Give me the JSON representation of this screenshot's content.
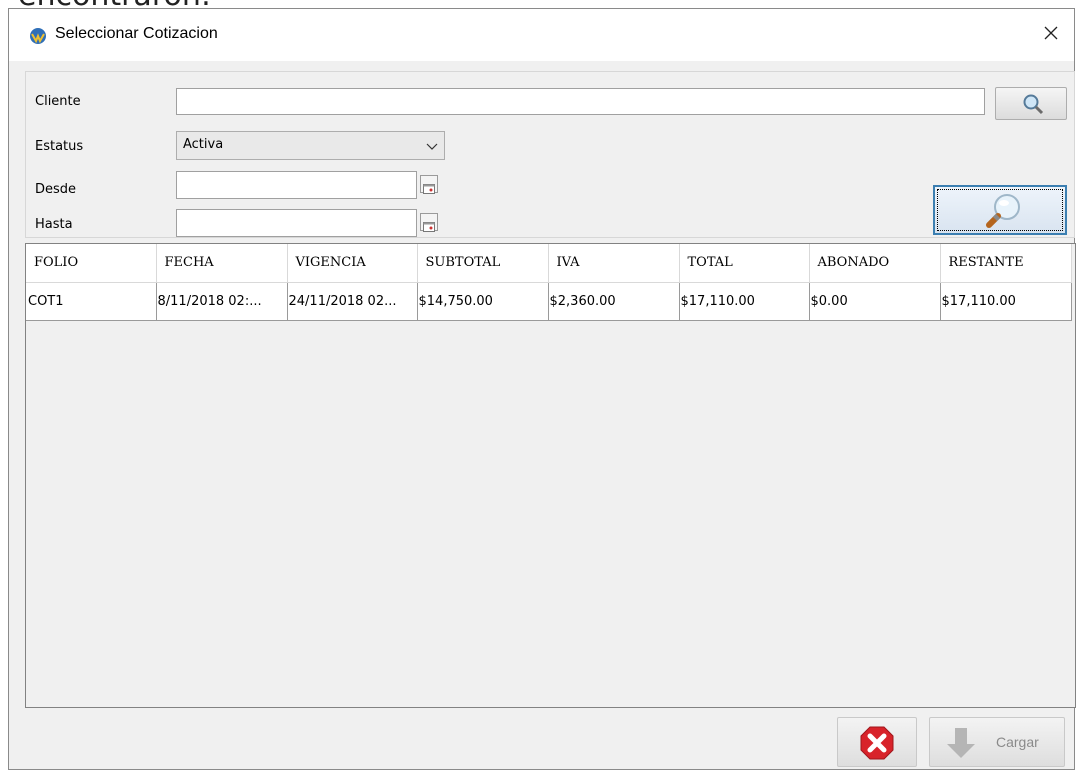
{
  "background_text": "encontraron:",
  "window": {
    "title": "Seleccionar Cotizacion",
    "close_glyph": "✕"
  },
  "filters": {
    "cliente_label": "Cliente",
    "cliente_value": "",
    "estatus_label": "Estatus",
    "estatus_value": "Activa",
    "desde_label": "Desde",
    "desde_value": "",
    "hasta_label": "Hasta",
    "hasta_value": ""
  },
  "table": {
    "columns": [
      "FOLIO",
      "FECHA",
      "VIGENCIA",
      "SUBTOTAL",
      "IVA",
      "TOTAL",
      "ABONADO",
      "RESTANTE"
    ],
    "rows": [
      [
        "COT1",
        "8/11/2018 02:...",
        "24/11/2018 02...",
        "$14,750.00",
        "$2,360.00",
        "$17,110.00",
        "$0.00",
        "$17,110.00"
      ]
    ]
  },
  "buttons": {
    "cancel_icon": "cancel-icon",
    "cargar_label": "Cargar"
  },
  "colors": {
    "window_bg": "#f0f0f0",
    "accent_border": "#3c7fb1",
    "cancel_red": "#d8232a"
  }
}
